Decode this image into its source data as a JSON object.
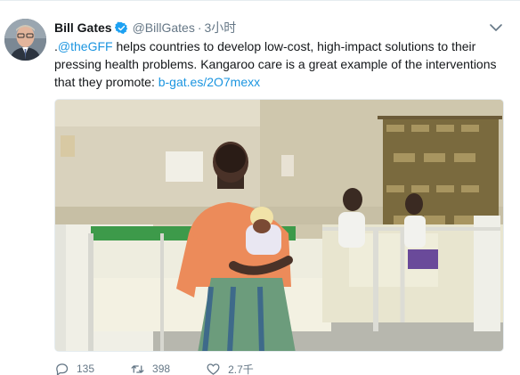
{
  "author": {
    "name": "Bill Gates",
    "handle": "@BillGates",
    "separator": "·",
    "time": "3小时",
    "verified": true
  },
  "tweet": {
    "text_prefix": ".",
    "mention": "@theGFF",
    "text_body": " helps countries to develop low-cost, high-impact solutions to their pressing health problems. Kangaroo care is a great example of the interventions that they promote: ",
    "link": "b-gat.es/2O7mexx"
  },
  "actions": {
    "reply_count": "135",
    "retweet_count": "398",
    "like_count": "2.7千"
  },
  "icons": {
    "verified": "verified-badge-icon",
    "caret": "chevron-down-icon",
    "reply": "reply-icon",
    "retweet": "retweet-icon",
    "like": "heart-icon"
  },
  "colors": {
    "link": "#1b95e0",
    "verified": "#1da1f2",
    "text": "#14171a",
    "secondary": "#657786"
  }
}
